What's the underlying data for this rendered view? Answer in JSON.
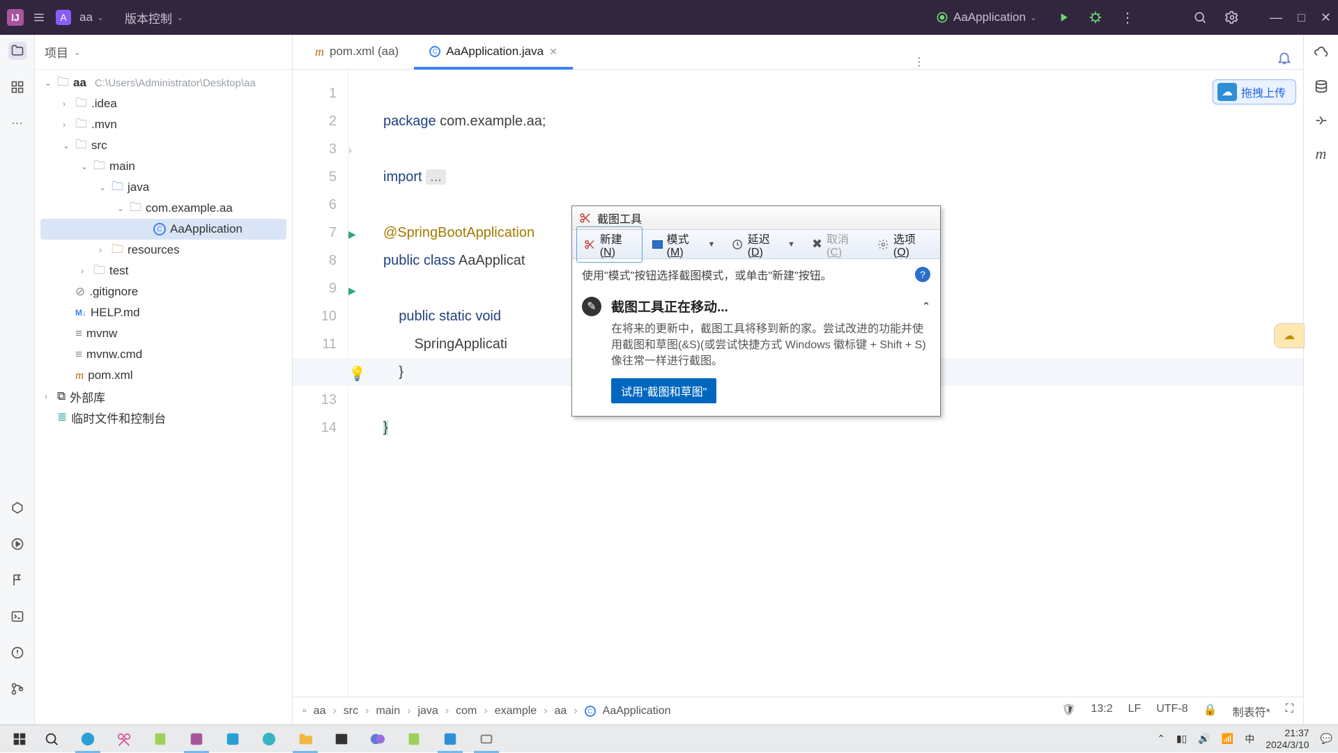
{
  "titlebar": {
    "project_badge": "A",
    "project_name": "aa",
    "version_control": "版本控制",
    "run_config": "AaApplication"
  },
  "project_panel": {
    "header": "项目",
    "tree": {
      "root_name": "aa",
      "root_path": "C:\\Users\\Administrator\\Desktop\\aa",
      "idea": ".idea",
      "mvn": ".mvn",
      "src": "src",
      "main": "main",
      "java": "java",
      "pkg": "com.example.aa",
      "app": "AaApplication",
      "resources": "resources",
      "test": "test",
      "gitignore": ".gitignore",
      "help": "HELP.md",
      "mvnw": "mvnw",
      "mvnwcmd": "mvnw.cmd",
      "pom": "pom.xml",
      "ext_libs": "外部库",
      "scratch": "临时文件和控制台"
    }
  },
  "tabs": {
    "t1": "pom.xml (aa)",
    "t2": "AaApplication.java"
  },
  "upload": {
    "label": "拖拽上传"
  },
  "code": {
    "l1": "package com.example.aa;",
    "l3a": "import ",
    "l3b": "...",
    "l6": "@SpringBootApplication",
    "l7": "public class AaApplicat",
    "l9": "    public static void",
    "l10": "        SpringApplicati",
    "l11": "    }",
    "l13": "}"
  },
  "breadcrumb": {
    "b1": "aa",
    "b2": "src",
    "b3": "main",
    "b4": "java",
    "b5": "com",
    "b6": "example",
    "b7": "aa",
    "b8": "AaApplication"
  },
  "status": {
    "pos": "13:2",
    "eol": "LF",
    "enc": "UTF-8",
    "indent": "制表符*"
  },
  "snip": {
    "title": "截图工具",
    "new": "新建(",
    "new_u": "N",
    "new2": ")",
    "mode": "模式(",
    "mode_u": "M",
    "mode2": ")",
    "delay": "延迟(",
    "delay_u": "D",
    "delay2": ")",
    "cancel": "取消(",
    "cancel_u": "C",
    "cancel2": ")",
    "options": "选项(",
    "options_u": "O",
    "options2": ")",
    "hint": "使用\"模式\"按钮选择截图模式，或单击\"新建\"按钮。",
    "notice_title": "截图工具正在移动...",
    "notice_desc": "在将来的更新中，截图工具将移到新的家。尝试改进的功能并使用截图和草图(&S)(或尝试快捷方式 Windows 徽标键 + Shift + S)像往常一样进行截图。",
    "notice_btn": "试用\"截图和草图\""
  },
  "tray": {
    "ime": "中",
    "time": "21:37",
    "date": "2024/3/10"
  }
}
